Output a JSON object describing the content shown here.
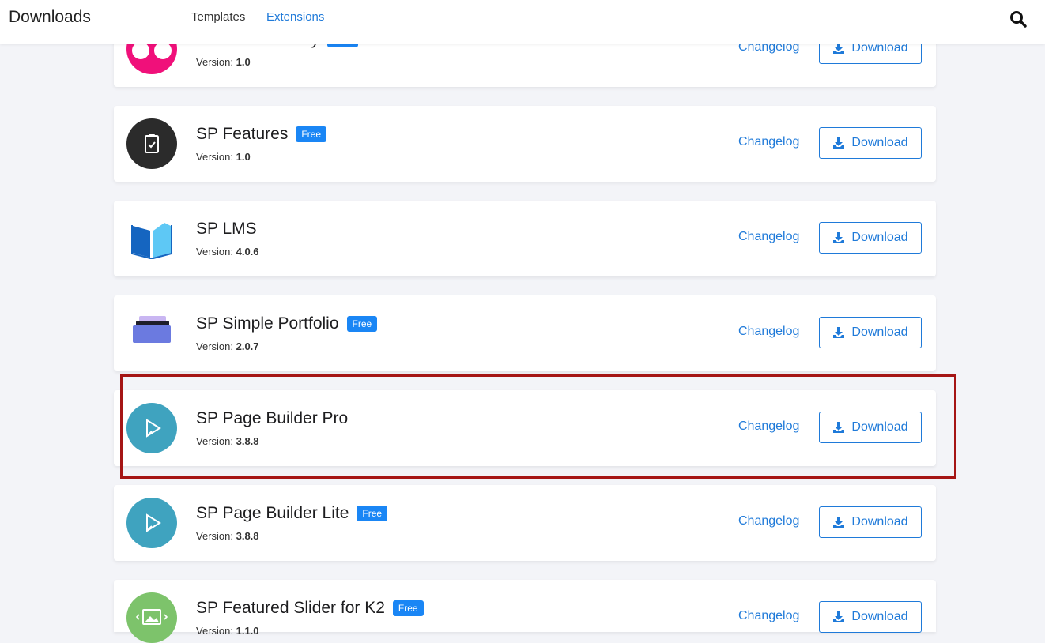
{
  "header": {
    "brand": "Downloads",
    "nav": [
      {
        "label": "Templates",
        "active": false
      },
      {
        "label": "Extensions",
        "active": true
      }
    ],
    "search_icon": "search-icon"
  },
  "colors": {
    "accent": "#1f7ad9",
    "badge": "#1a86f5",
    "highlight": "#a51515"
  },
  "extensions": [
    {
      "name": "SP Flickr Gallery",
      "badge": "Free",
      "version_label": "Version:",
      "version": "1.0",
      "changelog": "Changelog",
      "download": "Download",
      "icon": "flickr-icon"
    },
    {
      "name": "SP Features",
      "badge": "Free",
      "version_label": "Version:",
      "version": "1.0",
      "changelog": "Changelog",
      "download": "Download",
      "icon": "clipboard-check-icon"
    },
    {
      "name": "SP LMS",
      "badge": "",
      "version_label": "Version:",
      "version": "4.0.6",
      "changelog": "Changelog",
      "download": "Download",
      "icon": "open-book-icon"
    },
    {
      "name": "SP Simple Portfolio",
      "badge": "Free",
      "version_label": "Version:",
      "version": "2.0.7",
      "changelog": "Changelog",
      "download": "Download",
      "icon": "portfolio-stack-icon"
    },
    {
      "name": "SP Page Builder Pro",
      "badge": "",
      "version_label": "Version:",
      "version": "3.8.8",
      "changelog": "Changelog",
      "download": "Download",
      "icon": "page-builder-icon"
    },
    {
      "name": "SP Page Builder Lite",
      "badge": "Free",
      "version_label": "Version:",
      "version": "3.8.8",
      "changelog": "Changelog",
      "download": "Download",
      "icon": "page-builder-icon"
    },
    {
      "name": "SP Featured Slider for K2",
      "badge": "Free",
      "version_label": "Version:",
      "version": "1.1.0",
      "changelog": "Changelog",
      "download": "Download",
      "icon": "image-slider-icon"
    }
  ]
}
